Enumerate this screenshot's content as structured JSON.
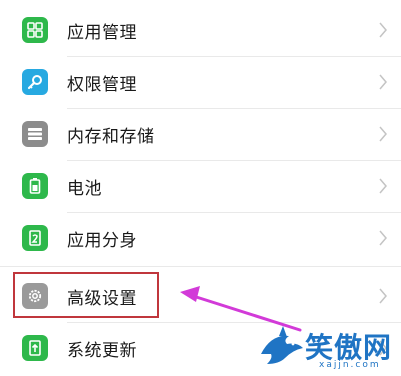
{
  "settings": {
    "items": [
      {
        "label": "应用管理",
        "icon": "apps-grid-icon",
        "icon_color": "#2eb84b"
      },
      {
        "label": "权限管理",
        "icon": "key-icon",
        "icon_color": "#27a9e1"
      },
      {
        "label": "内存和存储",
        "icon": "storage-list-icon",
        "icon_color": "#8c8c8c"
      },
      {
        "label": "电池",
        "icon": "battery-icon",
        "icon_color": "#2eb84b"
      },
      {
        "label": "应用分身",
        "icon": "app-clone-icon",
        "icon_color": "#2eb84b"
      },
      {
        "label": "高级设置",
        "icon": "gear-icon",
        "icon_color": "#9a9a9a"
      },
      {
        "label": "系统更新",
        "icon": "system-update-icon",
        "icon_color": "#2eb84b"
      }
    ]
  },
  "annotation": {
    "highlight_color": "#c0363c",
    "arrow_color": "#d23ad8"
  },
  "watermark": {
    "text": "笑傲网",
    "url": "xajjn.com",
    "color": "#1f74c4"
  }
}
